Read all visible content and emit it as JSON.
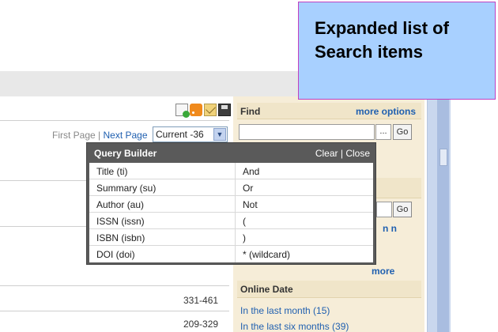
{
  "callout": {
    "text": "Expanded list of Search items"
  },
  "toolbar": {
    "icons": [
      "document-add-icon",
      "rss-icon",
      "email-icon",
      "save-icon"
    ]
  },
  "pagination": {
    "first_page": "First Page",
    "separator": "|",
    "next_page": "Next Page",
    "current_select": "Current -36"
  },
  "query_builder": {
    "title": "Query Builder",
    "clear": "Clear",
    "separator": "|",
    "close": "Close",
    "rows": [
      {
        "field": "Title (ti)",
        "op": "And"
      },
      {
        "field": "Summary (su)",
        "op": "Or"
      },
      {
        "field": "Author (au)",
        "op": "Not"
      },
      {
        "field": "ISSN (issn)",
        "op": "("
      },
      {
        "field": "ISBN (isbn)",
        "op": ")"
      },
      {
        "field": "DOI (doi)",
        "op": "* (wildcard)"
      }
    ]
  },
  "results": {
    "pages": [
      "331-461",
      "209-329"
    ]
  },
  "sidebar": {
    "find": {
      "label": "Find",
      "more_options": "more options",
      "dots": "...",
      "go": "Go"
    },
    "second": {
      "go": "Go",
      "fragment": "n n",
      "more": "more"
    },
    "online_date": {
      "label": "Online Date",
      "items": [
        "In the last month (15)",
        "In the last six months (39)"
      ]
    }
  },
  "colors": {
    "link": "#2060b0",
    "sidebar_bg": "#f6edd8",
    "callout_bg": "#a8d0ff",
    "callout_border": "#c040c0",
    "popup_header": "#5a5a5a"
  }
}
